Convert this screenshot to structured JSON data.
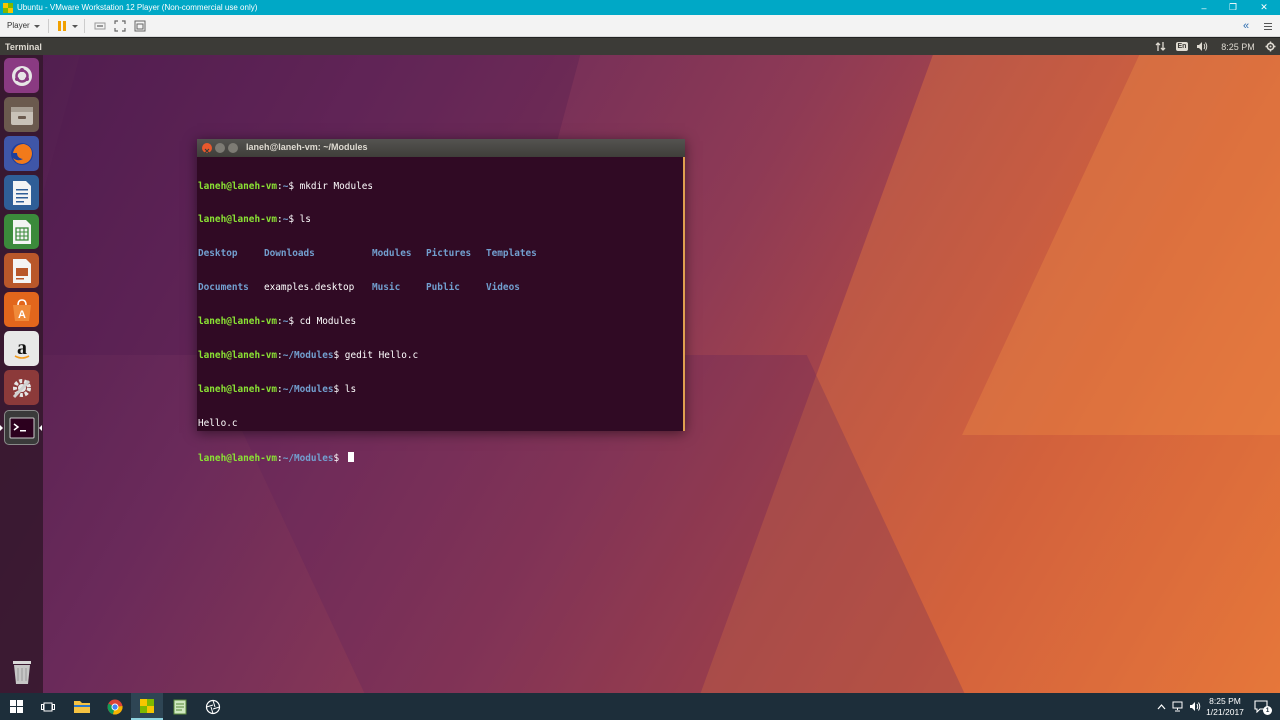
{
  "vmware": {
    "title": "Ubuntu - VMware Workstation 12 Player (Non-commercial use only)",
    "player_menu": "Player",
    "minimize": "–",
    "restore": "❐",
    "close": "✕",
    "collapse": "«"
  },
  "ubuntu_panel": {
    "app_title": "Terminal",
    "keyboard": "En",
    "time": "8:25 PM"
  },
  "terminal": {
    "title": "laneh@laneh-vm: ~/Modules",
    "lines": [
      {
        "user": "laneh@laneh-vm",
        "path": "~",
        "cmd": "mkdir Modules"
      },
      {
        "user": "laneh@laneh-vm",
        "path": "~",
        "cmd": "ls"
      },
      {
        "user": "laneh@laneh-vm",
        "path": "~",
        "cmd": "cd Modules"
      },
      {
        "user": "laneh@laneh-vm",
        "path": "~/Modules",
        "cmd": "gedit Hello.c"
      },
      {
        "user": "laneh@laneh-vm",
        "path": "~/Modules",
        "cmd": "ls"
      },
      {
        "output": "Hello.c"
      },
      {
        "user": "laneh@laneh-vm",
        "path": "~/Modules",
        "cmd": ""
      }
    ],
    "ls_row1": [
      "Desktop",
      "Downloads",
      "Modules",
      "Pictures",
      "Templates"
    ],
    "ls_row2": [
      "Documents",
      "examples.desktop",
      "Music",
      "Public",
      "Videos"
    ],
    "prompt_sep": ":",
    "prompt_end": "$ "
  },
  "launcher": [
    {
      "name": "Search your computer",
      "icon": "dash-icon"
    },
    {
      "name": "Files",
      "icon": "files-icon"
    },
    {
      "name": "Firefox Web Browser",
      "icon": "firefox-icon"
    },
    {
      "name": "LibreOffice Writer",
      "icon": "writer-icon"
    },
    {
      "name": "LibreOffice Calc",
      "icon": "calc-icon"
    },
    {
      "name": "LibreOffice Impress",
      "icon": "impress-icon"
    },
    {
      "name": "Ubuntu Software",
      "icon": "software-icon",
      "glyph": "A"
    },
    {
      "name": "Amazon",
      "icon": "amazon-icon",
      "glyph": "a"
    },
    {
      "name": "System Settings",
      "icon": "settings-icon"
    },
    {
      "name": "Terminal",
      "icon": "terminal-icon",
      "glyph": ">_"
    },
    {
      "name": "Trash",
      "icon": "trash-icon"
    }
  ],
  "taskbar": {
    "clock_time": "8:25 PM",
    "clock_date": "1/21/2017",
    "notification_count": "1"
  },
  "colors": {
    "vm_title": "#00a8c6",
    "terminal_bg": "#300a24",
    "prompt_user": "#8ae234",
    "prompt_path": "#729fcf",
    "ubuntu_panel": "#3c3b37",
    "taskbar": "#1d2e3a"
  }
}
